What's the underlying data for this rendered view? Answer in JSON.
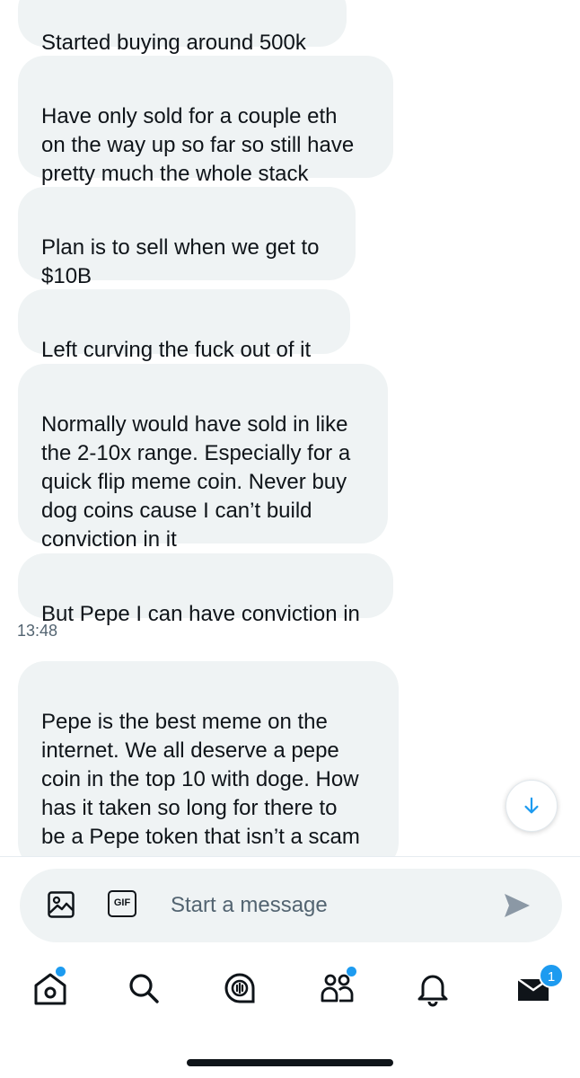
{
  "messages": [
    {
      "text": "Started buying around 500k"
    },
    {
      "text": "Have only sold for a couple eth\non the way up so far so still have\npretty much the whole stack"
    },
    {
      "text": "Plan is to sell when we get to\n$10B"
    },
    {
      "text": "Left curving the fuck out of it"
    },
    {
      "text": "Normally would have sold in like\nthe 2-10x range. Especially for a\nquick flip meme coin. Never buy\ndog coins cause I can’t build\nconviction in it"
    },
    {
      "text": "But Pepe I can have conviction in"
    },
    {
      "text": "Pepe is the best meme on the\ninternet. We all deserve a pepe\ncoin in the top 10 with doge. How\nhas it taken so long for there to\nbe a Pepe token that isn’t a scam\nthat lasts a couple hours"
    }
  ],
  "timestamp": "13:48",
  "composer": {
    "placeholder": "Start a message",
    "gif_label": "GIF",
    "icons": [
      "image-icon",
      "gif-icon",
      "send-icon"
    ]
  },
  "tabbar": {
    "items": [
      "home",
      "search",
      "spaces",
      "communities",
      "notifications",
      "messages"
    ],
    "messages_badge": "1"
  },
  "colors": {
    "bubble": "#eff3f4",
    "accent": "#1d9bf0",
    "text": "#0f1419",
    "muted": "#536471"
  }
}
